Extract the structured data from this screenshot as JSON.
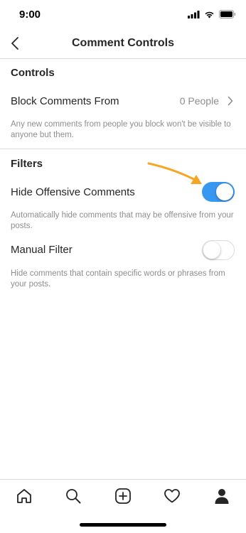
{
  "status": {
    "time": "9:00"
  },
  "header": {
    "title": "Comment Controls"
  },
  "controls": {
    "heading": "Controls",
    "block_label": "Block Comments From",
    "block_value": "0 People",
    "block_description": "Any new comments from people you block won't be visible to anyone but them."
  },
  "filters": {
    "heading": "Filters",
    "offensive_label": "Hide Offensive Comments",
    "offensive_on": true,
    "offensive_description": "Automatically hide comments that may be offensive from your posts.",
    "manual_label": "Manual Filter",
    "manual_on": false,
    "manual_description": "Hide comments that contain specific words or phrases from your posts."
  },
  "colors": {
    "toggle_on": "#3897f0",
    "arrow": "#f5a623",
    "text": "#262626",
    "secondary": "#8e8e8e"
  },
  "tabs": [
    "home-icon",
    "search-icon",
    "add-icon",
    "heart-icon",
    "profile-icon"
  ]
}
